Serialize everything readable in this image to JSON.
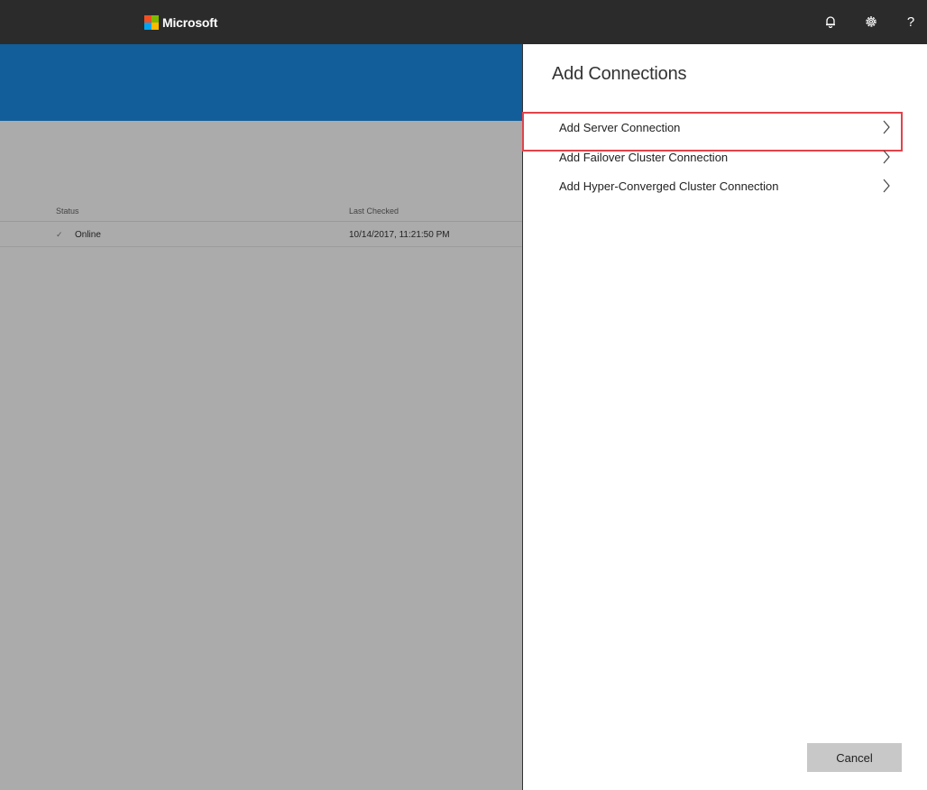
{
  "topbar": {
    "brand": "Microsoft",
    "logo_colors": [
      "#f25022",
      "#7fba00",
      "#00a4ef",
      "#ffb900"
    ],
    "icons": [
      "bell-icon",
      "gear-icon",
      "help-icon"
    ],
    "help_glyph": "?"
  },
  "left": {
    "columns": {
      "status": "Status",
      "last_checked": "Last Checked"
    },
    "rows": [
      {
        "status": "Online",
        "last_checked": "10/14/2017, 11:21:50 PM"
      }
    ]
  },
  "panel": {
    "title": "Add Connections",
    "items": [
      {
        "label": "Add Server Connection",
        "highlighted": true
      },
      {
        "label": "Add Failover Cluster Connection",
        "highlighted": false
      },
      {
        "label": "Add Hyper-Converged Cluster Connection",
        "highlighted": false
      }
    ],
    "cancel": "Cancel"
  },
  "colors": {
    "topbar": "#2b2b2b",
    "banner": "#115e9a",
    "overlay": "#ababab",
    "highlight": "#e2434b"
  }
}
